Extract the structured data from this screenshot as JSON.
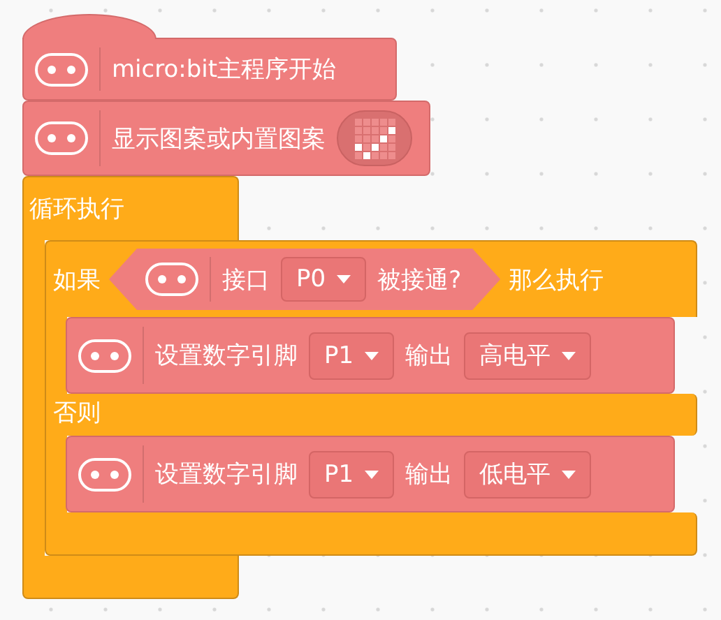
{
  "canvas": {
    "blocks": [
      {
        "kind": "hat",
        "parts": [
          {
            "kind": "label",
            "text": "micro:bit主程序开始"
          }
        ]
      },
      {
        "kind": "command",
        "parts": [
          {
            "kind": "label",
            "text": "显示图案或内置图案"
          },
          {
            "kind": "pattern",
            "lit": [
              [
                false,
                false,
                false,
                false,
                false
              ],
              [
                false,
                false,
                false,
                false,
                true
              ],
              [
                false,
                false,
                false,
                true,
                false
              ],
              [
                true,
                false,
                true,
                false,
                false
              ],
              [
                false,
                true,
                false,
                false,
                false
              ]
            ]
          }
        ]
      },
      {
        "kind": "forever",
        "label": "循环执行",
        "body": [
          {
            "kind": "if_else",
            "if_label": "如果",
            "then_label": "那么执行",
            "else_label": "否则",
            "condition": {
              "parts": [
                {
                  "kind": "label",
                  "text": "接口"
                },
                {
                  "kind": "dropdown",
                  "value": "P0"
                },
                {
                  "kind": "label",
                  "text": "被接通?"
                }
              ]
            },
            "then": [
              {
                "kind": "command",
                "parts": [
                  {
                    "kind": "label",
                    "text": "设置数字引脚"
                  },
                  {
                    "kind": "dropdown",
                    "value": "P1"
                  },
                  {
                    "kind": "label",
                    "text": "输出"
                  },
                  {
                    "kind": "dropdown",
                    "value": "高电平"
                  }
                ]
              }
            ],
            "else": [
              {
                "kind": "command",
                "parts": [
                  {
                    "kind": "label",
                    "text": "设置数字引脚"
                  },
                  {
                    "kind": "dropdown",
                    "value": "P1"
                  },
                  {
                    "kind": "label",
                    "text": "输出"
                  },
                  {
                    "kind": "dropdown",
                    "value": "低电平"
                  }
                ]
              }
            ]
          }
        ]
      }
    ]
  }
}
